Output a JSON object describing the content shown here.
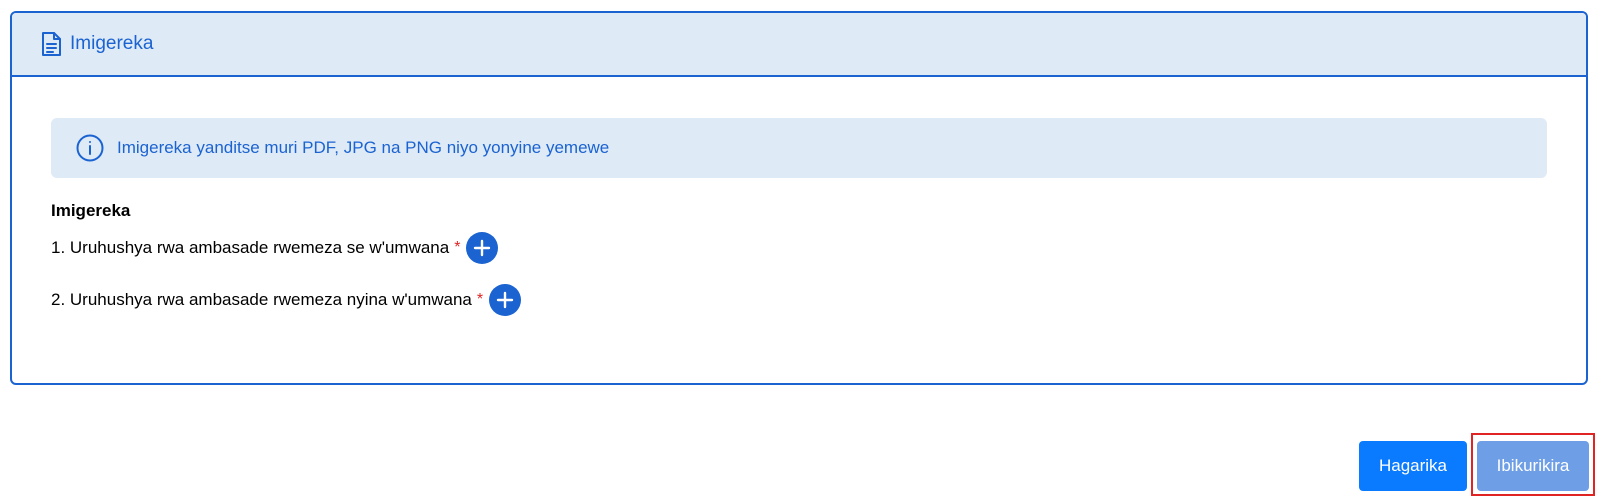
{
  "card": {
    "title": "Imigereka",
    "icon": "file-text-icon"
  },
  "alert": {
    "icon": "info-circle-icon",
    "text": "Imigereka yanditse muri PDF, JPG na PNG niyo yonyine yemewe"
  },
  "attachments": {
    "title": "Imigereka",
    "items": [
      {
        "label": "1. Uruhushya rwa ambasade rwemeza se w'umwana",
        "required_mark": "*",
        "add_icon": "plus-circle-icon"
      },
      {
        "label": "2. Uruhushya rwa ambasade rwemeza nyina w'umwana",
        "required_mark": "*",
        "add_icon": "plus-circle-icon"
      }
    ]
  },
  "actions": {
    "cancel_label": "Hagarika",
    "submit_label": "Ibikurikira"
  },
  "colors": {
    "accent": "#1a63d1",
    "panel_bg": "#dfeaf7",
    "cancel_bg": "#0a7bff",
    "submit_bg_disabled": "#6e9ee6",
    "required": "#e02424",
    "highlight": "#e02424"
  }
}
